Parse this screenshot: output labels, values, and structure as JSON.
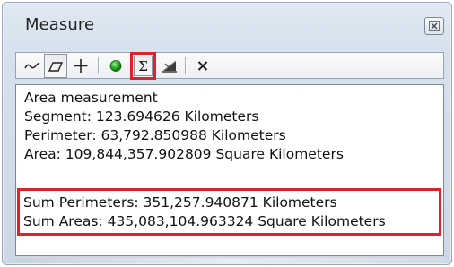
{
  "window": {
    "title": "Measure",
    "close_icon": "close-icon"
  },
  "toolbar": {
    "tools": [
      {
        "name": "measure-line-icon",
        "state": "normal"
      },
      {
        "name": "measure-area-icon",
        "state": "pressed"
      },
      {
        "name": "measure-feature-icon",
        "state": "normal"
      },
      {
        "name": "snap-to-feature-icon",
        "state": "normal",
        "color": "#1fa81f"
      },
      {
        "name": "show-total-icon",
        "state": "highlighted",
        "glyph": "Σ"
      },
      {
        "name": "choose-units-icon",
        "state": "normal"
      },
      {
        "name": "clear-results-icon",
        "state": "normal"
      }
    ]
  },
  "results": {
    "mode": "Area measurement",
    "segment": "Segment: 123.694626 Kilometers",
    "perimeter": "Perimeter: 63,792.850988 Kilometers",
    "area": "Area: 109,844,357.902809 Square Kilometers",
    "sum_perimeters": "Sum Perimeters: 351,257.940871 Kilometers",
    "sum_areas": "Sum Areas: 435,083,104.963324 Square Kilometers"
  },
  "colors": {
    "highlight": "#e0202a",
    "window_bg": "#d6e1ed"
  }
}
